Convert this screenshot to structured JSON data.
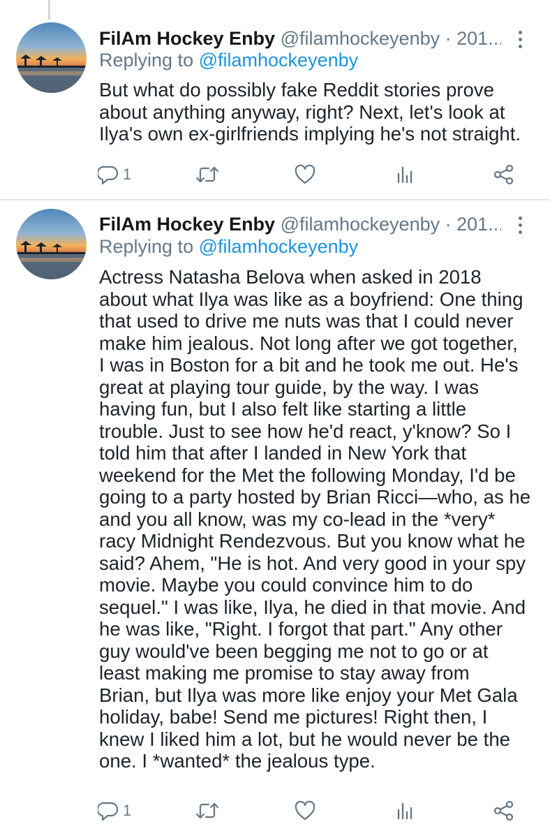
{
  "tweets": [
    {
      "author_name": "FilAm Hockey Enby",
      "handle": "@filamhockeyenby",
      "separator": "·",
      "date": "201...",
      "replying_prefix": "Replying to",
      "replying_to": "@filamhockeyenby",
      "body_lines": [
        "But what do possibly fake Reddit stories prove",
        "about anything anyway, right? Next, let's look at",
        "Ilya's own ex-girlfriends implying he's not straight."
      ],
      "reply_count": "1"
    },
    {
      "author_name": "FilAm Hockey Enby",
      "handle": "@filamhockeyenby",
      "separator": "·",
      "date": "201...",
      "replying_prefix": "Replying to",
      "replying_to": "@filamhockeyenby",
      "body_lines": [
        "Actress Natasha Belova when asked in 2018",
        "about what Ilya was like as a boyfriend: One thing",
        "that used to drive me nuts was that I could never",
        "make him jealous. Not long after we got together,",
        "I was in Boston for a bit and he took me out. He's",
        "great at playing tour guide, by the way. I was",
        "having fun, but I also felt like starting a little",
        "trouble. Just to see how he'd react, y'know? So I",
        "told him that after I landed in New York that",
        "weekend for the Met the following Monday, I'd be",
        "going to a party hosted by Brian Ricci—who, as he",
        "and you all know, was my co-lead in the *very*",
        "racy Midnight Rendezvous. But you know what he",
        "said? Ahem, \"He is hot. And very good in your spy",
        "movie. Maybe you could convince him to do",
        "sequel.\" I was like, Ilya, he died in that movie. And",
        "he was like, \"Right. I forgot that part.\" Any other",
        "guy would've been begging me not to go or at",
        "least making me promise to stay away from",
        "Brian, but Ilya was more like enjoy your Met Gala",
        "holiday, babe! Send me pictures! Right then, I",
        "knew I liked him a lot, but he would never be the",
        "one. I *wanted* the jealous type."
      ],
      "reply_count": "1"
    }
  ],
  "icons": {
    "reply": "reply-icon",
    "retweet": "retweet-icon",
    "like": "heart-icon",
    "stats": "analytics-icon",
    "share": "share-icon",
    "more": "more-vertical-icon"
  },
  "colors": {
    "name": "#14171a",
    "secondary": "#657786",
    "mention": "#1b95e0",
    "divider": "#e1e8ed"
  }
}
